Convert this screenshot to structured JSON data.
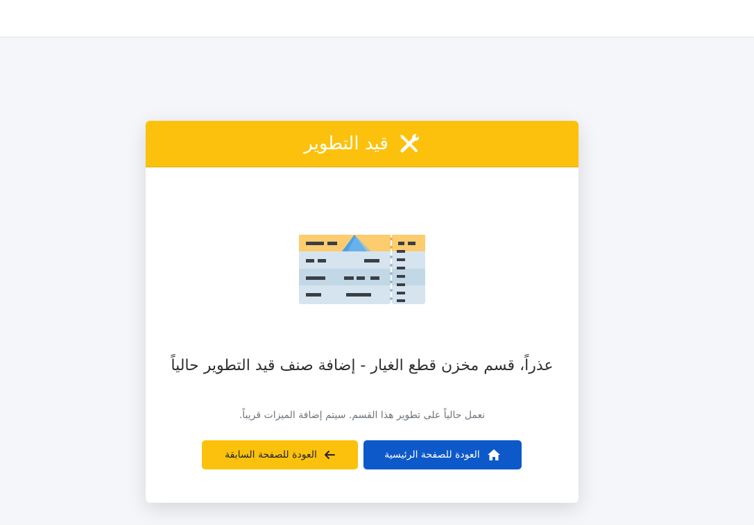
{
  "card": {
    "title": "قيد التطوير",
    "title_icon": "tools-icon",
    "header_color": "#fcc10c",
    "illustration": "boarding-ticket-icon",
    "message": "عذراً، قسم مخزن قطع الغيار - إضافة صنف قيد التطوير حالياً",
    "subtitle": "نعمل حالياً على تطوير هذا القسم. سيتم إضافة الميزات قريباً."
  },
  "buttons": {
    "home": {
      "label": "العودة للصفحة الرئيسية",
      "icon": "home-icon",
      "color": "#0d59c9"
    },
    "back": {
      "label": "العودة للصفحة السابقة",
      "icon": "arrow-left-icon",
      "color": "#fcc10c"
    }
  }
}
